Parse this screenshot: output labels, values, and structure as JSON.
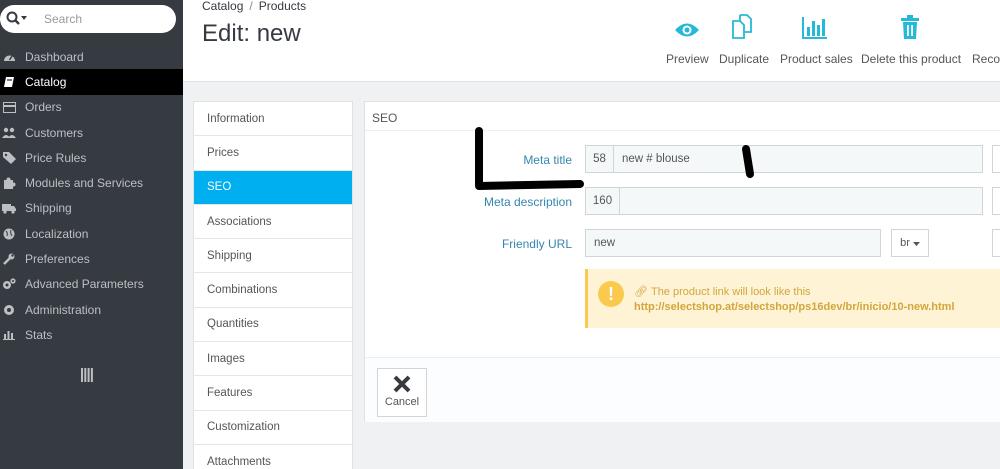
{
  "sidebar": {
    "search": {
      "placeholder": "Search",
      "icon": "search-icon"
    },
    "items": [
      {
        "label": "Dashboard",
        "icon": "dashboard-icon",
        "active": false
      },
      {
        "label": "Catalog",
        "icon": "book-icon",
        "active": true
      },
      {
        "label": "Orders",
        "icon": "credit-card-icon",
        "active": false
      },
      {
        "label": "Customers",
        "icon": "users-icon",
        "active": false
      },
      {
        "label": "Price Rules",
        "icon": "tags-icon",
        "active": false
      },
      {
        "label": "Modules and Services",
        "icon": "puzzle-icon",
        "active": false
      },
      {
        "label": "Shipping",
        "icon": "truck-icon",
        "active": false
      },
      {
        "label": "Localization",
        "icon": "globe-icon",
        "active": false
      },
      {
        "label": "Preferences",
        "icon": "wrench-icon",
        "active": false
      },
      {
        "label": "Advanced Parameters",
        "icon": "cogs-icon",
        "active": false
      },
      {
        "label": "Administration",
        "icon": "gear-icon",
        "active": false
      },
      {
        "label": "Stats",
        "icon": "bar-chart-icon",
        "active": false
      }
    ]
  },
  "header": {
    "breadcrumb": [
      "Catalog",
      "Products"
    ],
    "title": "Edit: new",
    "toolbar": [
      {
        "label": "Preview",
        "icon": "eye-icon"
      },
      {
        "label": "Duplicate",
        "icon": "copy-icon"
      },
      {
        "label": "Product sales",
        "icon": "bar-chart-icon"
      },
      {
        "label": "Delete this product",
        "icon": "trash-icon"
      },
      {
        "label": "Recor",
        "icon": ""
      }
    ]
  },
  "tabs": [
    "Information",
    "Prices",
    "SEO",
    "Associations",
    "Shipping",
    "Combinations",
    "Quantities",
    "Images",
    "Features",
    "Customization",
    "Attachments"
  ],
  "active_tab": "SEO",
  "panel": {
    "heading": "SEO",
    "meta_title": {
      "label": "Meta title",
      "counter": "58",
      "value": "new # blouse"
    },
    "meta_description": {
      "label": "Meta description",
      "counter": "160",
      "value": ""
    },
    "friendly_url": {
      "label": "Friendly URL",
      "value": "new",
      "lang": "br"
    },
    "alert": {
      "line1": "The product link will look like this",
      "line2": "http://selectshop.at/selectshop/ps16dev/br/inicio/10-new.html",
      "icon": "exclamation-icon"
    },
    "cancel_label": "Cancel"
  },
  "colors": {
    "sidebar_bg": "#363a41",
    "accent": "#00aff0",
    "label_blue": "#3586ae",
    "alert_bg": "#fff3d6",
    "alert_text": "#d2a63c"
  }
}
